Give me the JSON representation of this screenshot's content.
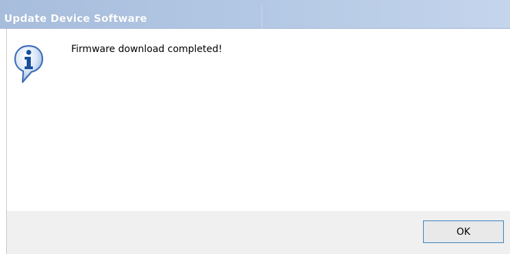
{
  "dialog": {
    "title": "Update Device Software",
    "message": "Firmware download completed!",
    "icon": "info-icon",
    "ok_label": "OK"
  },
  "colors": {
    "title_bar": "#b3c8e4",
    "title_text": "#ffffff",
    "footer": "#f0f0f0",
    "button_border": "#3c7fb1"
  }
}
